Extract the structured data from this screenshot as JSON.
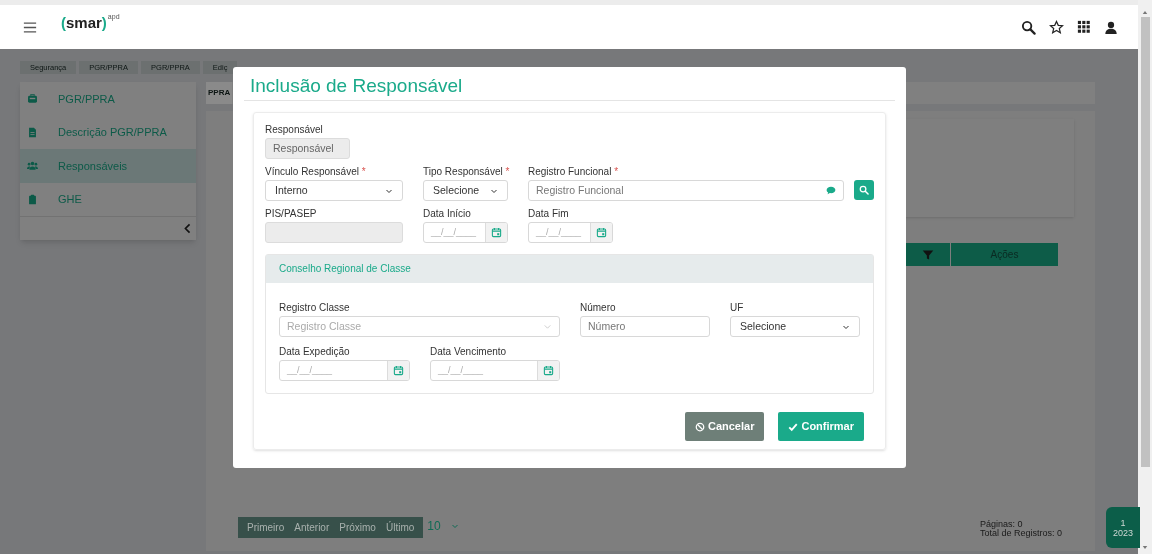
{
  "topbar": {
    "logo": {
      "open": "(",
      "name": "smar",
      "close": ")",
      "sup": "apd"
    }
  },
  "breadcrumbs": [
    "Segurança",
    "PGR/PPRA",
    "PGR/PPRA",
    "Ediç"
  ],
  "sidebar": {
    "items": [
      {
        "label": "PGR/PPRA",
        "selected": false
      },
      {
        "label": "Descrição PGR/PPRA",
        "selected": false
      },
      {
        "label": "Responsáveis",
        "selected": true
      },
      {
        "label": "GHE",
        "selected": false
      }
    ]
  },
  "tabs": [
    {
      "label": "PPRA",
      "selected": true
    }
  ],
  "table": {
    "columns": [
      {
        "kind": "filter"
      },
      {
        "kind": "text",
        "label": "Ações"
      }
    ]
  },
  "pagination": {
    "buttons": [
      "Primeiro",
      "Anterior",
      "Próximo",
      "Último"
    ],
    "page_size": "10",
    "pages": "Páginas: 0",
    "total": "Total de Registros: 0"
  },
  "year_badge": {
    "month": "1",
    "year": "2023"
  },
  "dialog": {
    "title": "Inclusão de Responsável",
    "rows": [
      [
        {
          "kind": "text",
          "label": "Responsável",
          "value": "Responsável",
          "disabled": true
        }
      ],
      [
        {
          "kind": "select",
          "label": "Vínculo Responsável",
          "asterisk": "*",
          "value": "Interno",
          "disabled": false
        },
        {
          "kind": "select",
          "label": "Tipo Responsável",
          "asterisk": "*",
          "value": "Selecione",
          "disabled": false
        },
        {
          "kind": "lookup",
          "label": "Registro Funcional",
          "asterisk": "*",
          "placeholder": "Registro Funcional",
          "disabled": false
        }
      ],
      [
        {
          "kind": "text",
          "label": "PIS/PASEP",
          "disabled": true
        },
        {
          "kind": "date",
          "label": "Data Início",
          "placeholder": "__/__/____",
          "disabled": false
        },
        {
          "kind": "date",
          "label": "Data Fim",
          "placeholder": "__/__/____",
          "disabled": false
        }
      ]
    ],
    "section": {
      "title": "Conselho Regional de Classe",
      "rows": [
        [
          {
            "kind": "combo",
            "label": "Registro Classe",
            "placeholder": "Registro Classe",
            "disabled": false
          },
          {
            "kind": "text",
            "label": "Número",
            "placeholder": "Número",
            "disabled": false
          },
          {
            "kind": "select",
            "label": "UF",
            "value": "Selecione",
            "disabled": false
          }
        ],
        [
          {
            "kind": "date",
            "label": "Data Expedição",
            "placeholder": "__/__/____",
            "disabled": false
          },
          {
            "kind": "date",
            "label": "Data Vencimento",
            "placeholder": "__/__/____",
            "disabled": false
          }
        ]
      ]
    },
    "buttons": [
      {
        "kind": "cancel",
        "label": "Cancelar"
      },
      {
        "kind": "confirm",
        "label": "Confirmar"
      }
    ]
  }
}
